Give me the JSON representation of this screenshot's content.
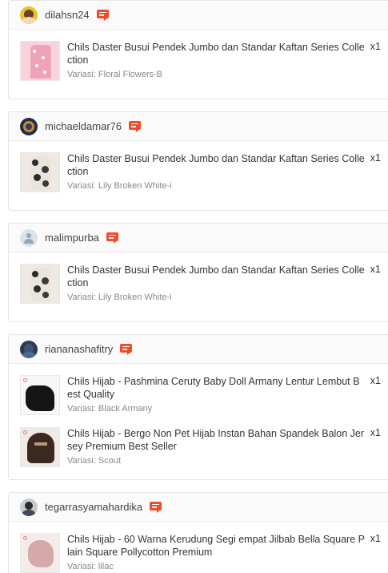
{
  "orders": [
    {
      "username": "dilahsn24",
      "items": [
        {
          "title": "Chils Daster Busui Pendek Jumbo dan Standar Kaftan Series Collection",
          "qty": "x1",
          "variant": "Variasi: Floral Flowers-B"
        }
      ]
    },
    {
      "username": "michaeldamar76",
      "items": [
        {
          "title": "Chils Daster Busui Pendek Jumbo dan Standar Kaftan Series Collection",
          "qty": "x1",
          "variant": "Variasi: Lily Broken White-i"
        }
      ]
    },
    {
      "username": "malimpurba",
      "items": [
        {
          "title": "Chils Daster Busui Pendek Jumbo dan Standar Kaftan Series Collection",
          "qty": "x1",
          "variant": "Variasi: Lily Broken White-i"
        }
      ]
    },
    {
      "username": "riananashafitry",
      "items": [
        {
          "title": "Chils Hijab - Pashmina Ceruty Baby Doll Armany Lentur Lembut Best Quality",
          "qty": "x1",
          "variant": "Variasi: Black Armany"
        },
        {
          "title": "Chils Hijab - Bergo Non Pet Hijab Instan Bahan Spandek Balon Jersey Premium Best Seller",
          "qty": "x1",
          "variant": "Variasi: Scout"
        }
      ]
    },
    {
      "username": "tegarrasyamahardika",
      "items": [
        {
          "title": "Chils Hijab - 60 Warna Kerudung Segi empat Jilbab Bella Square Plain Square Pollycotton Premium",
          "qty": "x1",
          "variant": "Variasi: lilac"
        }
      ]
    }
  ],
  "icons": {
    "chat": "chat-icon",
    "avatar_default": "user-icon"
  },
  "colors": {
    "accent": "#ee4d2d"
  }
}
